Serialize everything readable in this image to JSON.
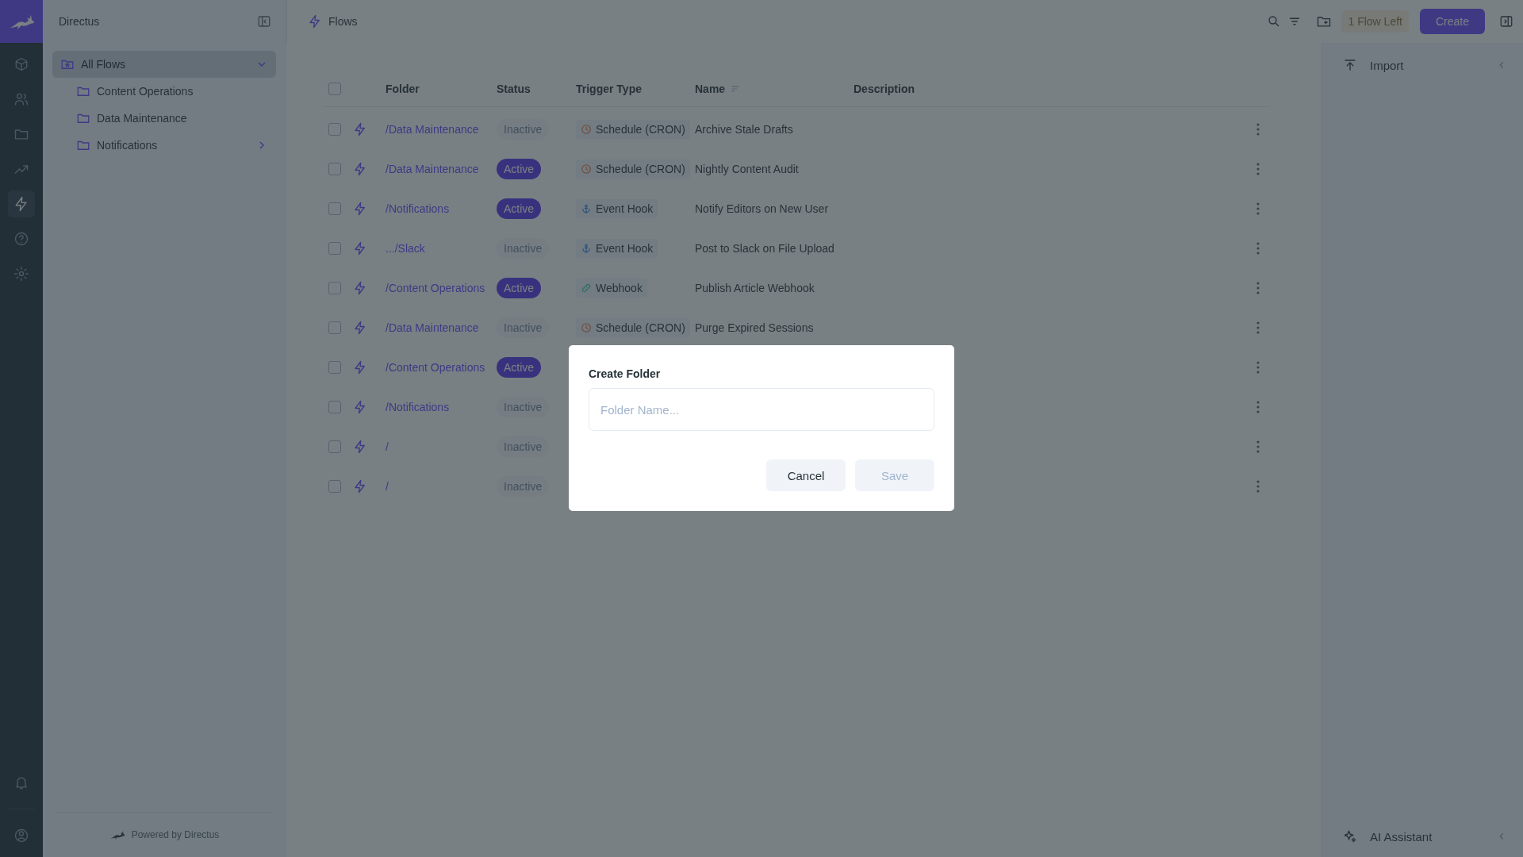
{
  "app": {
    "name": "Directus"
  },
  "rail": [
    {
      "kind": "cube",
      "selected": false
    },
    {
      "kind": "users",
      "selected": false
    },
    {
      "kind": "folder",
      "selected": false
    },
    {
      "kind": "chart",
      "selected": false
    },
    {
      "kind": "bolt",
      "selected": true
    },
    {
      "kind": "help",
      "selected": false
    },
    {
      "kind": "gear",
      "selected": false
    }
  ],
  "rail_bottom": [
    {
      "kind": "bell"
    },
    {
      "kind": "user"
    }
  ],
  "nav": {
    "items": [
      {
        "label": "All Flows",
        "selected": true,
        "expanded": true,
        "children": [
          {
            "label": "Content Operations",
            "selected": false
          },
          {
            "label": "Data Maintenance",
            "selected": false
          },
          {
            "label": "Notifications",
            "selected": false,
            "expanded": false
          }
        ]
      }
    ],
    "footer": "Powered by Directus"
  },
  "header": {
    "title": "Flows",
    "flows_left": "1 Flow Left",
    "create": "Create"
  },
  "table": {
    "select_all": false,
    "columns": [
      {
        "label": "Folder",
        "sorted": false
      },
      {
        "label": "Status",
        "sorted": false
      },
      {
        "label": "Trigger Type",
        "sorted": false
      },
      {
        "label": "Name",
        "sorted": true
      },
      {
        "label": "Description",
        "sorted": false
      }
    ],
    "rows": [
      {
        "checked": false,
        "folder": "/Data Maintenance",
        "status": {
          "label": "Inactive",
          "active": false
        },
        "trigger": {
          "kind": "schedule",
          "label": "Schedule (CRON)"
        },
        "name": "Archive Stale Drafts"
      },
      {
        "checked": false,
        "folder": "/Data Maintenance",
        "status": {
          "label": "Active",
          "active": true
        },
        "trigger": {
          "kind": "schedule",
          "label": "Schedule (CRON)"
        },
        "name": "Nightly Content Audit"
      },
      {
        "checked": false,
        "folder": "/Notifications",
        "status": {
          "label": "Active",
          "active": true
        },
        "trigger": {
          "kind": "event",
          "label": "Event Hook"
        },
        "name": "Notify Editors on New User"
      },
      {
        "checked": false,
        "folder": ".../Slack",
        "status": {
          "label": "Inactive",
          "active": false
        },
        "trigger": {
          "kind": "event",
          "label": "Event Hook"
        },
        "name": "Post to Slack on File Upload"
      },
      {
        "checked": false,
        "folder": "/Content Operations",
        "status": {
          "label": "Active",
          "active": true
        },
        "trigger": {
          "kind": "webhook",
          "label": "Webhook"
        },
        "name": "Publish Article Webhook"
      },
      {
        "checked": false,
        "folder": "/Data Maintenance",
        "status": {
          "label": "Inactive",
          "active": false
        },
        "trigger": {
          "kind": "schedule",
          "label": "Schedule (CRON)"
        },
        "name": "Purge Expired Sessions"
      },
      {
        "checked": false,
        "folder": "/Content Operations",
        "status": {
          "label": "Active",
          "active": true
        }
      },
      {
        "checked": false,
        "folder": "/Notifications",
        "status": {
          "label": "Inactive",
          "active": false
        }
      },
      {
        "checked": false,
        "folder": "/",
        "status": {
          "label": "Inactive",
          "active": false
        }
      },
      {
        "checked": false,
        "folder": "/",
        "status": {
          "label": "Inactive",
          "active": false
        }
      }
    ]
  },
  "sidebar": [
    {
      "kind": "import",
      "label": "Import"
    },
    {
      "kind": "ai",
      "label": "AI Assistant"
    }
  ],
  "modal": {
    "title": "Create Folder",
    "placeholder": "Folder Name...",
    "buttons": [
      {
        "label": "Cancel",
        "disabled": false
      },
      {
        "label": "Save",
        "disabled": true
      }
    ]
  }
}
